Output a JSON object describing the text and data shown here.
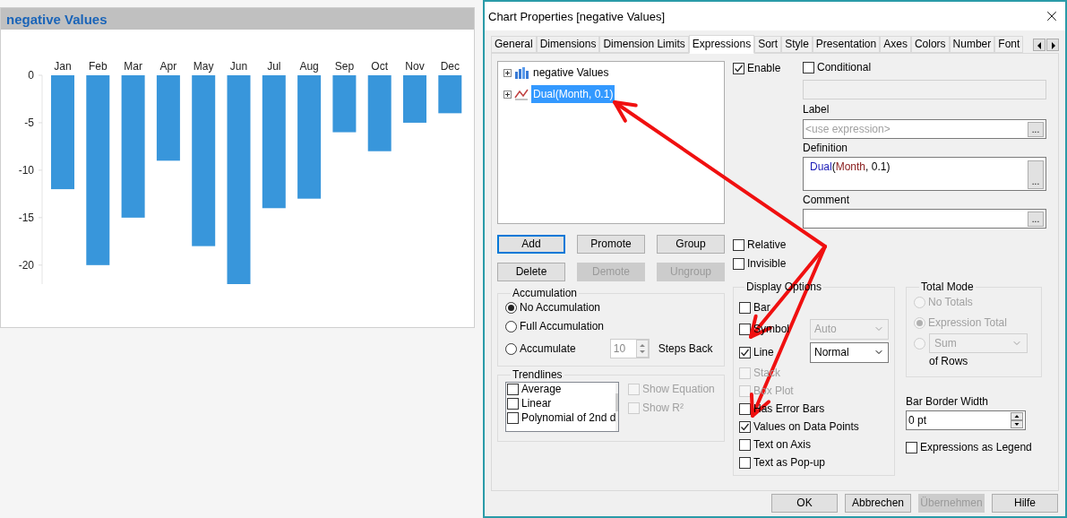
{
  "chart_panel": {
    "title": "negative Values",
    "chart_data": {
      "type": "bar",
      "categories": [
        "Jan",
        "Feb",
        "Mar",
        "Apr",
        "May",
        "Jun",
        "Jul",
        "Aug",
        "Sep",
        "Oct",
        "Nov",
        "Dec"
      ],
      "series": [
        {
          "color": "#3896db",
          "values": [
            -12,
            -20,
            -15,
            -9,
            -18,
            -22,
            -14,
            -13,
            -6,
            -8,
            -5,
            -4
          ]
        }
      ],
      "yticks": [
        0,
        -5,
        -10,
        -15,
        -20
      ],
      "ylim": [
        -22,
        0
      ]
    }
  },
  "dialog": {
    "title": "Chart Properties [negative Values]",
    "tabs": [
      {
        "label": "General",
        "selected": false
      },
      {
        "label": "Dimensions",
        "selected": false
      },
      {
        "label": "Dimension Limits",
        "selected": false
      },
      {
        "label": "Expressions",
        "selected": true
      },
      {
        "label": "Sort",
        "selected": false
      },
      {
        "label": "Style",
        "selected": false
      },
      {
        "label": "Presentation",
        "selected": false
      },
      {
        "label": "Axes",
        "selected": false
      },
      {
        "label": "Colors",
        "selected": false
      },
      {
        "label": "Number",
        "selected": false
      },
      {
        "label": "Font",
        "selected": false
      }
    ],
    "expressions": [
      {
        "label": "negative Values",
        "kind": "bar",
        "selected": false
      },
      {
        "label": "Dual(Month, 0.1)",
        "kind": "line",
        "selected": true
      }
    ],
    "expression_buttons": [
      {
        "label": "Add",
        "disabled": false,
        "focused": true
      },
      {
        "label": "Promote",
        "disabled": false,
        "focused": false
      },
      {
        "label": "Group",
        "disabled": false,
        "focused": false
      },
      {
        "label": "Delete",
        "disabled": false,
        "focused": false
      },
      {
        "label": "Demote",
        "disabled": true,
        "focused": false
      },
      {
        "label": "Ungroup",
        "disabled": true,
        "focused": false
      }
    ],
    "enable": {
      "label": "Enable",
      "checked": true
    },
    "conditional": {
      "label": "Conditional",
      "checked": false
    },
    "label_field": {
      "label": "Label",
      "placeholder": "<use expression>",
      "browse": "..."
    },
    "definition": {
      "label": "Definition",
      "browse": "...",
      "tokens": [
        {
          "text": "Dual",
          "kind": "function"
        },
        {
          "text": "(",
          "kind": "plain"
        },
        {
          "text": "Month",
          "kind": "field"
        },
        {
          "text": ", 0.1)",
          "kind": "plain"
        }
      ]
    },
    "comment": {
      "label": "Comment",
      "browse": "..."
    },
    "flags": [
      {
        "label": "Relative",
        "checked": false
      },
      {
        "label": "Invisible",
        "checked": false
      }
    ],
    "accumulation": {
      "title": "Accumulation",
      "options": [
        {
          "label": "No Accumulation",
          "selected": true
        },
        {
          "label": "Full Accumulation",
          "selected": false
        },
        {
          "label": "Accumulate",
          "selected": false
        }
      ],
      "steps": "10",
      "steps_label": "Steps Back"
    },
    "trendlines": {
      "title": "Trendlines",
      "items": [
        {
          "label": "Average",
          "checked": false
        },
        {
          "label": "Linear",
          "checked": false
        },
        {
          "label": "Polynomial of 2nd d",
          "checked": false
        }
      ],
      "options": [
        {
          "label": "Show Equation",
          "checked": false,
          "disabled": true
        },
        {
          "label": "Show R²",
          "checked": false,
          "disabled": true
        }
      ]
    },
    "display_options": {
      "title": "Display Options",
      "items": [
        {
          "label": "Bar",
          "checked": false,
          "disabled": false
        },
        {
          "label": "Symbol",
          "checked": false,
          "disabled": false,
          "select": {
            "value": "Auto",
            "disabled": true
          }
        },
        {
          "label": "Line",
          "checked": true,
          "disabled": false,
          "select": {
            "value": "Normal",
            "disabled": false
          }
        },
        {
          "label": "Stack",
          "checked": false,
          "disabled": true
        },
        {
          "label": "Box Plot",
          "checked": false,
          "disabled": true
        },
        {
          "label": "Has Error Bars",
          "checked": false,
          "disabled": false
        },
        {
          "label": "Values on Data Points",
          "checked": true,
          "disabled": false
        },
        {
          "label": "Text on Axis",
          "checked": false,
          "disabled": false
        },
        {
          "label": "Text as Pop-up",
          "checked": false,
          "disabled": false
        }
      ]
    },
    "total_mode": {
      "title": "Total Mode",
      "disabled": true,
      "options": [
        {
          "label": "No Totals",
          "selected": false
        },
        {
          "label": "Expression Total",
          "selected": true
        },
        {
          "selected": false
        }
      ],
      "sum_select": "Sum",
      "suffix": "of Rows"
    },
    "bar_border_width": {
      "label": "Bar Border Width",
      "value": "0 pt"
    },
    "expressions_as_legend": {
      "label": "Expressions as Legend",
      "checked": false
    },
    "footer_buttons": [
      {
        "label": "OK",
        "disabled": false
      },
      {
        "label": "Abbrechen",
        "disabled": false
      },
      {
        "label": "Übernehmen",
        "disabled": true
      },
      {
        "label": "Hilfe",
        "disabled": false
      }
    ]
  }
}
